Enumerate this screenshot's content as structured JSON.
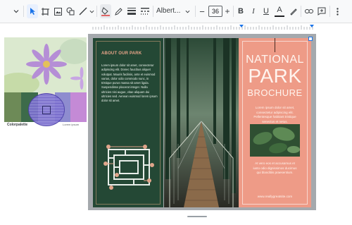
{
  "toolbar": {
    "font_name": "Albert...",
    "font_size": "36",
    "minus_label": "−",
    "plus_label": "+",
    "bold_label": "B",
    "italic_label": "I",
    "underline_label": "U",
    "text_color_label": "A"
  },
  "collage": {
    "label": "Colorpalette",
    "small_caption": "Lorem ipsum"
  },
  "brochure": {
    "about_title": "ABOUT OUR PARK",
    "about_body": "Lorem ipsum dolor sit amet, consectetur adipiscing elit. Donec faucibus aliquet volutpat. Mauris facilisis, ante et euismod varius, dolor odio commodo nunc, in tristique purus massa sit amet ligula. Suspendisse placerat integer. Nulla ultricies nisi augue, vitae aliquam dui ultricies sed. Aenean euismod lorem ipsum dolor sit amet.",
    "title_line1": "NATIONAL",
    "title_line2": "PARK",
    "title_line3": "BROCHURE",
    "right_body": "Lorem ipsum dolor sit amet, consectetur adipiscing elit. Pellentesque habitant tristique senectus et netus.",
    "right_body2": "At vero eos et accusamus et iusto odio dignissimos ducimus qui blanditiis praesentium.",
    "website": "www.reallygreatsite.com"
  },
  "colors": {
    "dark_green": "#244835",
    "salmon": "#ee9b87",
    "selection_blue": "#1a73e8",
    "maze_accent": "#e0a58b"
  },
  "icons": [
    "chevron-down-icon",
    "cursor-icon",
    "crop-icon",
    "image-icon",
    "shapes-icon",
    "line-icon",
    "fill-color-icon",
    "pen-icon",
    "border-weight-icon",
    "border-dash-icon",
    "highlighter-icon",
    "link-icon",
    "comment-icon",
    "more-icon"
  ]
}
